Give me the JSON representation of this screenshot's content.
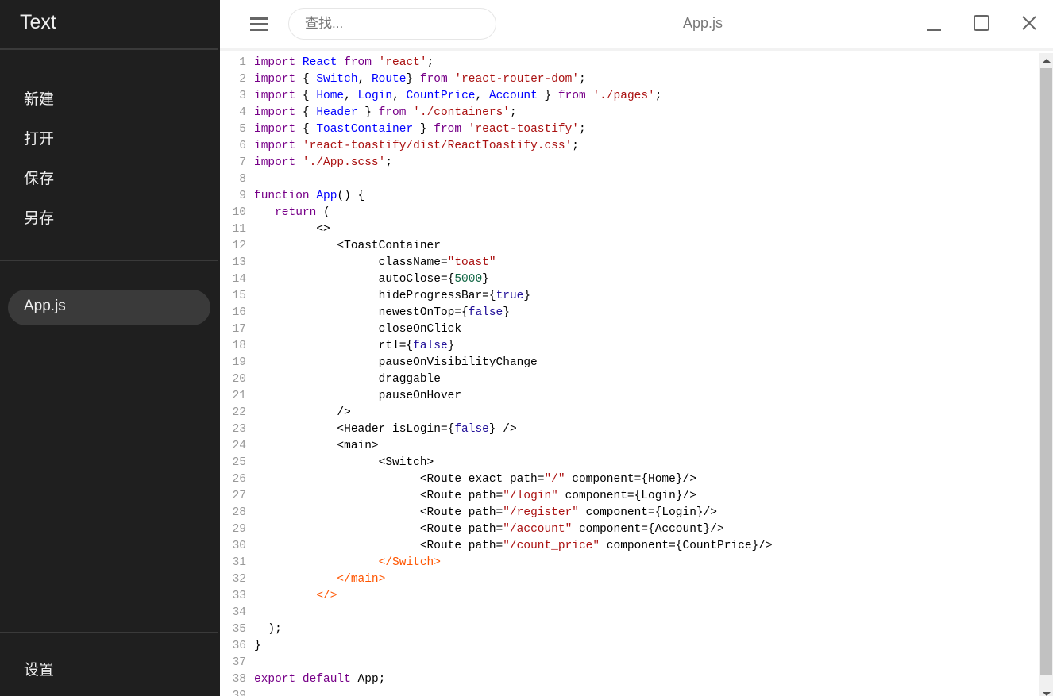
{
  "sidebar": {
    "app_title": "Text",
    "menu": [
      {
        "label": "新建"
      },
      {
        "label": "打开"
      },
      {
        "label": "保存"
      },
      {
        "label": "另存"
      }
    ],
    "files": [
      {
        "label": "App.js",
        "active": true
      }
    ],
    "settings_label": "设置"
  },
  "topbar": {
    "search_placeholder": "查找...",
    "title": "App.js"
  },
  "editor": {
    "lines": [
      [
        [
          "k",
          "import"
        ],
        [
          "p",
          " "
        ],
        [
          "v",
          "React"
        ],
        [
          "p",
          " "
        ],
        [
          "k",
          "from"
        ],
        [
          "p",
          " "
        ],
        [
          "s",
          "'react'"
        ],
        [
          "p",
          ";"
        ]
      ],
      [
        [
          "k",
          "import"
        ],
        [
          "p",
          " { "
        ],
        [
          "v",
          "Switch"
        ],
        [
          "p",
          ", "
        ],
        [
          "v",
          "Route"
        ],
        [
          "p",
          "} "
        ],
        [
          "k",
          "from"
        ],
        [
          "p",
          " "
        ],
        [
          "s",
          "'react-router-dom'"
        ],
        [
          "p",
          ";"
        ]
      ],
      [
        [
          "k",
          "import"
        ],
        [
          "p",
          " { "
        ],
        [
          "v",
          "Home"
        ],
        [
          "p",
          ", "
        ],
        [
          "v",
          "Login"
        ],
        [
          "p",
          ", "
        ],
        [
          "v",
          "CountPrice"
        ],
        [
          "p",
          ", "
        ],
        [
          "v",
          "Account"
        ],
        [
          "p",
          " } "
        ],
        [
          "k",
          "from"
        ],
        [
          "p",
          " "
        ],
        [
          "s",
          "'./pages'"
        ],
        [
          "p",
          ";"
        ]
      ],
      [
        [
          "k",
          "import"
        ],
        [
          "p",
          " { "
        ],
        [
          "v",
          "Header"
        ],
        [
          "p",
          " } "
        ],
        [
          "k",
          "from"
        ],
        [
          "p",
          " "
        ],
        [
          "s",
          "'./containers'"
        ],
        [
          "p",
          ";"
        ]
      ],
      [
        [
          "k",
          "import"
        ],
        [
          "p",
          " { "
        ],
        [
          "v",
          "ToastContainer"
        ],
        [
          "p",
          " } "
        ],
        [
          "k",
          "from"
        ],
        [
          "p",
          " "
        ],
        [
          "s",
          "'react-toastify'"
        ],
        [
          "p",
          ";"
        ]
      ],
      [
        [
          "k",
          "import"
        ],
        [
          "p",
          " "
        ],
        [
          "s",
          "'react-toastify/dist/ReactToastify.css'"
        ],
        [
          "p",
          ";"
        ]
      ],
      [
        [
          "k",
          "import"
        ],
        [
          "p",
          " "
        ],
        [
          "s",
          "'./App.scss'"
        ],
        [
          "p",
          ";"
        ]
      ],
      [],
      [
        [
          "k",
          "function"
        ],
        [
          "p",
          " "
        ],
        [
          "v",
          "App"
        ],
        [
          "p",
          "() {"
        ]
      ],
      [
        [
          "p",
          "   "
        ],
        [
          "k",
          "return"
        ],
        [
          "p",
          " ("
        ]
      ],
      [
        [
          "p",
          "         <>"
        ]
      ],
      [
        [
          "p",
          "            <ToastContainer"
        ]
      ],
      [
        [
          "p",
          "                  className="
        ],
        [
          "s",
          "\"toast\""
        ]
      ],
      [
        [
          "p",
          "                  autoClose={"
        ],
        [
          "n",
          "5000"
        ],
        [
          "p",
          "}"
        ]
      ],
      [
        [
          "p",
          "                  hideProgressBar={"
        ],
        [
          "a",
          "true"
        ],
        [
          "p",
          "}"
        ]
      ],
      [
        [
          "p",
          "                  newestOnTop={"
        ],
        [
          "a",
          "false"
        ],
        [
          "p",
          "}"
        ]
      ],
      [
        [
          "p",
          "                  closeOnClick"
        ]
      ],
      [
        [
          "p",
          "                  rtl={"
        ],
        [
          "a",
          "false"
        ],
        [
          "p",
          "}"
        ]
      ],
      [
        [
          "p",
          "                  pauseOnVisibilityChange"
        ]
      ],
      [
        [
          "p",
          "                  draggable"
        ]
      ],
      [
        [
          "p",
          "                  pauseOnHover"
        ]
      ],
      [
        [
          "p",
          "            />"
        ]
      ],
      [
        [
          "p",
          "            <Header isLogin={"
        ],
        [
          "a",
          "false"
        ],
        [
          "p",
          "} />"
        ]
      ],
      [
        [
          "p",
          "            <main>"
        ]
      ],
      [
        [
          "p",
          "                  <Switch>"
        ]
      ],
      [
        [
          "p",
          "                        <Route exact path="
        ],
        [
          "s",
          "\"/\""
        ],
        [
          "p",
          " component={Home}/>"
        ]
      ],
      [
        [
          "p",
          "                        <Route path="
        ],
        [
          "s",
          "\"/login\""
        ],
        [
          "p",
          " component={Login}/>"
        ]
      ],
      [
        [
          "p",
          "                        <Route path="
        ],
        [
          "s",
          "\"/register\""
        ],
        [
          "p",
          " component={Login}/>"
        ]
      ],
      [
        [
          "p",
          "                        <Route path="
        ],
        [
          "s",
          "\"/account\""
        ],
        [
          "p",
          " component={Account}/>"
        ]
      ],
      [
        [
          "p",
          "                        <Route path="
        ],
        [
          "s",
          "\"/count_price\""
        ],
        [
          "p",
          " component={CountPrice}/>"
        ]
      ],
      [
        [
          "p",
          "                  "
        ],
        [
          "t",
          "</Switch>"
        ]
      ],
      [
        [
          "p",
          "            "
        ],
        [
          "t",
          "</main>"
        ]
      ],
      [
        [
          "p",
          "         "
        ],
        [
          "t",
          "</>"
        ]
      ],
      [],
      [
        [
          "p",
          "  );"
        ]
      ],
      [
        [
          "p",
          "}"
        ]
      ],
      [],
      [
        [
          "k",
          "export"
        ],
        [
          "p",
          " "
        ],
        [
          "k",
          "default"
        ],
        [
          "p",
          " App;"
        ]
      ],
      []
    ]
  }
}
